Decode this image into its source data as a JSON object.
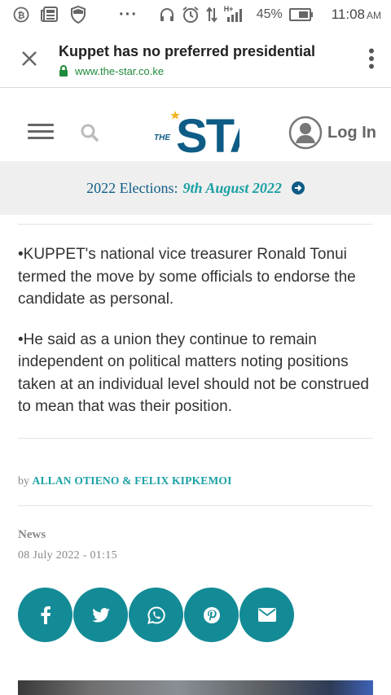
{
  "status_bar": {
    "battery_percent": "45%",
    "time": "11:08",
    "ampm": "AM",
    "more": "···",
    "network_label": "H+"
  },
  "browser": {
    "page_title": "Kuppet has no preferred presidential",
    "url": "www.the-star.co.ke"
  },
  "site": {
    "logo_the": "THE",
    "logo_star": "STAR",
    "login_label": "Log In"
  },
  "banner": {
    "label": "2022 Elections:",
    "date": "9th August 2022"
  },
  "article": {
    "bullets": [
      "•KUPPET's national vice treasurer Ronald Tonui termed the move by some officials to endorse the candidate as personal.",
      "•He said as a union they continue to remain independent on political matters noting positions taken at an individual level should not be construed to mean that was their position."
    ],
    "by_prefix": "by",
    "authors": "ALLAN OTIENO & FELIX KIPKEMOI",
    "category": "News",
    "date": "08 July 2022 - 01:15"
  },
  "share": {
    "buttons": [
      "facebook-icon",
      "twitter-icon",
      "whatsapp-icon",
      "pinterest-icon",
      "email-icon"
    ]
  },
  "colors": {
    "brand_blue": "#0e5c86",
    "accent_teal": "#1aa0a4",
    "share_bg": "#138b96"
  }
}
